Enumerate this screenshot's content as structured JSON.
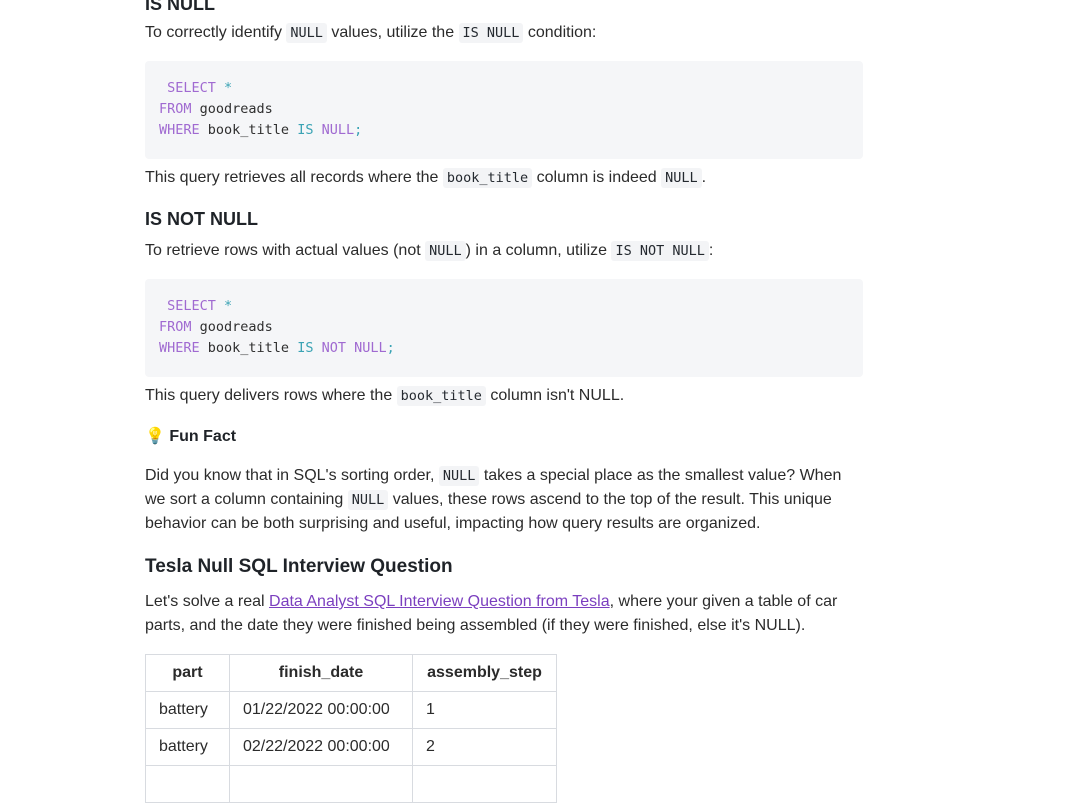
{
  "section_is_null": {
    "heading": "IS NULL",
    "intro_pre": "To correctly identify ",
    "intro_code1": "NULL",
    "intro_mid": " values, utilize the ",
    "intro_code2": "IS NULL",
    "intro_post": " condition:",
    "code_lines": [
      {
        "kw": "SELECT",
        "rest": " *"
      },
      {
        "kw": "FROM",
        "rest": " goodreads"
      },
      {
        "kw": "WHERE",
        "rest": " book_title ",
        "op": "IS",
        "kw2": "NULL",
        "end": ";"
      }
    ],
    "after_pre": "This query retrieves all records where the ",
    "after_code1": "book_title",
    "after_mid": " column is indeed ",
    "after_code2": "NULL",
    "after_post": "."
  },
  "section_is_not_null": {
    "heading": "IS NOT NULL",
    "intro_pre": "To retrieve rows with actual values (not ",
    "intro_code1": "NULL",
    "intro_mid": ") in a column, utilize ",
    "intro_code2": "IS NOT NULL",
    "intro_post": ":",
    "code_lines": [
      {
        "kw": "SELECT",
        "rest": " *"
      },
      {
        "kw": "FROM",
        "rest": " goodreads"
      },
      {
        "kw": "WHERE",
        "rest": " book_title ",
        "op": "IS",
        "op2": "NOT",
        "kw2": "NULL",
        "end": ";"
      }
    ],
    "after_pre": "This query delivers rows where the ",
    "after_code1": "book_title",
    "after_post": " column isn't NULL."
  },
  "fun_fact": {
    "icon": "💡",
    "heading": "Fun Fact",
    "l1_pre": "Did you know that in SQL's sorting order, ",
    "l1_code": "NULL",
    "l1_post": " takes a special place as the smallest value? When",
    "l2_pre": "we sort a column containing ",
    "l2_code": "NULL",
    "l2_post": " values, these rows ascend to the top of the result. This unique",
    "l3": "behavior can be both surprising and useful, impacting how query results are organized."
  },
  "tesla": {
    "heading": "Tesla Null SQL Interview Question",
    "l1_pre": "Let's solve a real ",
    "link": "Data Analyst SQL Interview Question from Tesla",
    "l1_post": ", where your given a table of car",
    "l2": "parts, and the date they were finished being assembled (if they were finished, else it's NULL).",
    "table": {
      "headers": [
        "part",
        "finish_date",
        "assembly_step"
      ],
      "rows": [
        [
          "battery",
          "01/22/2022 00:00:00",
          "1"
        ],
        [
          "battery",
          "02/22/2022 00:00:00",
          "2"
        ],
        [
          "",
          "",
          ""
        ]
      ]
    }
  }
}
